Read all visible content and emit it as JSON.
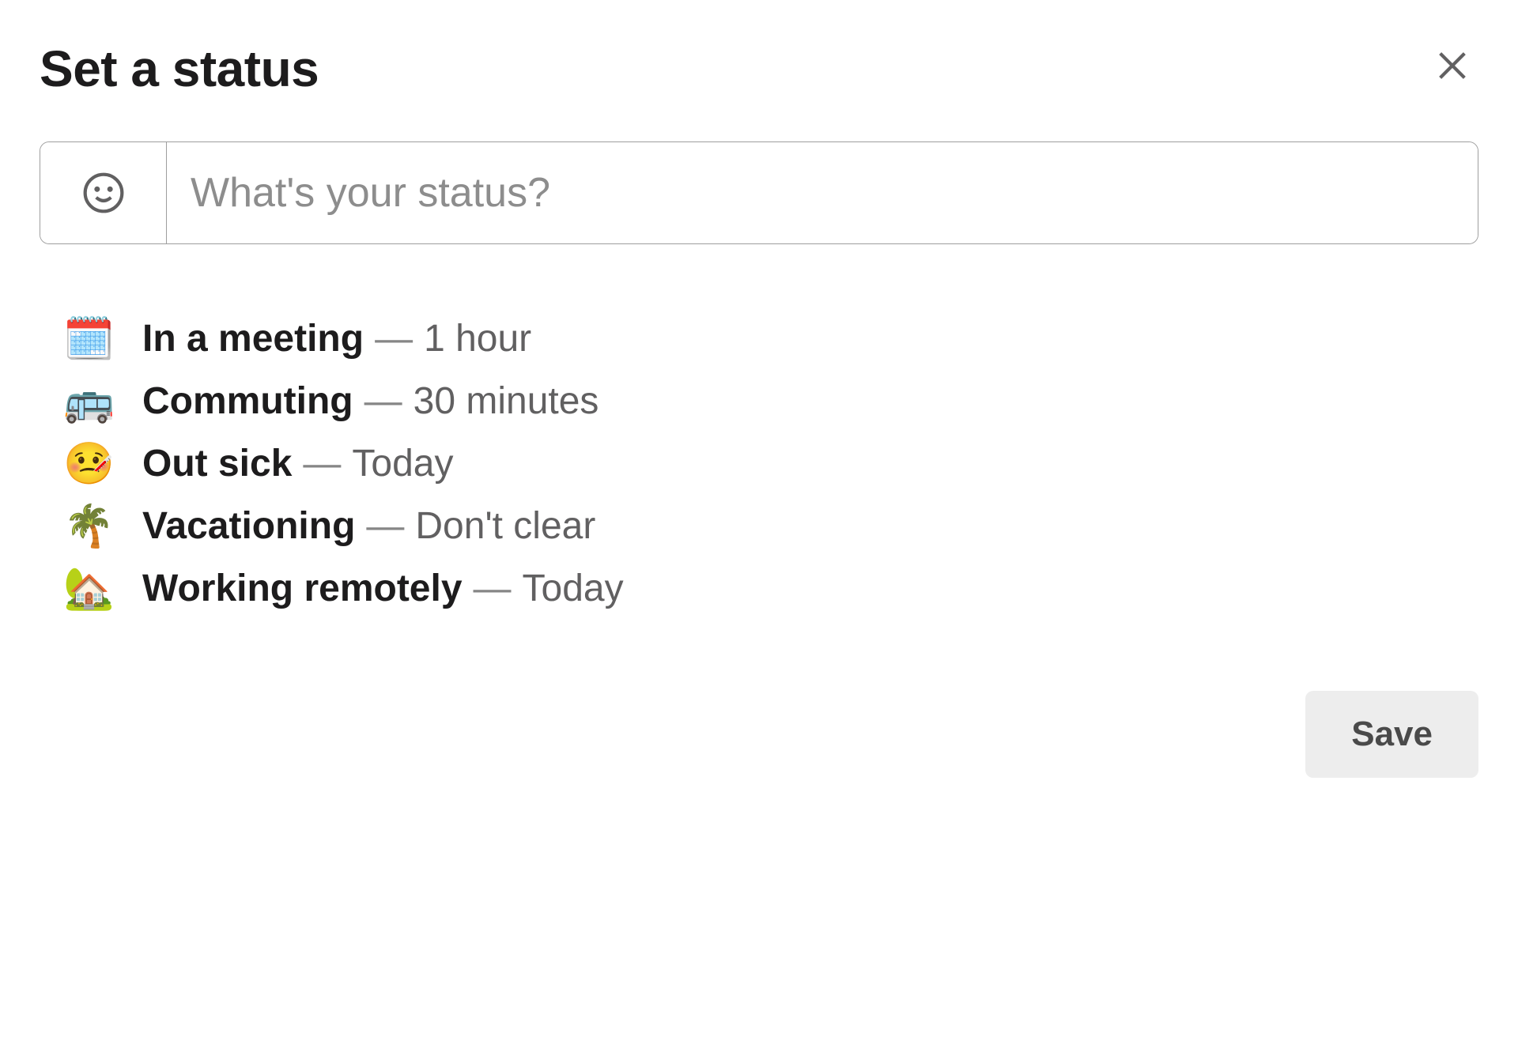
{
  "header": {
    "title": "Set a status"
  },
  "input": {
    "placeholder": "What's your status?",
    "value": ""
  },
  "suggestions": [
    {
      "emoji": "🗓️",
      "label": "In a meeting",
      "separator": "—",
      "duration": "1 hour"
    },
    {
      "emoji": "🚌",
      "label": "Commuting",
      "separator": "—",
      "duration": "30 minutes"
    },
    {
      "emoji": "🤒",
      "label": "Out sick",
      "separator": "—",
      "duration": "Today"
    },
    {
      "emoji": "🌴",
      "label": "Vacationing",
      "separator": "—",
      "duration": "Don't clear"
    },
    {
      "emoji": "🏡",
      "label": "Working remotely",
      "separator": "—",
      "duration": "Today"
    }
  ],
  "footer": {
    "save_label": "Save"
  }
}
